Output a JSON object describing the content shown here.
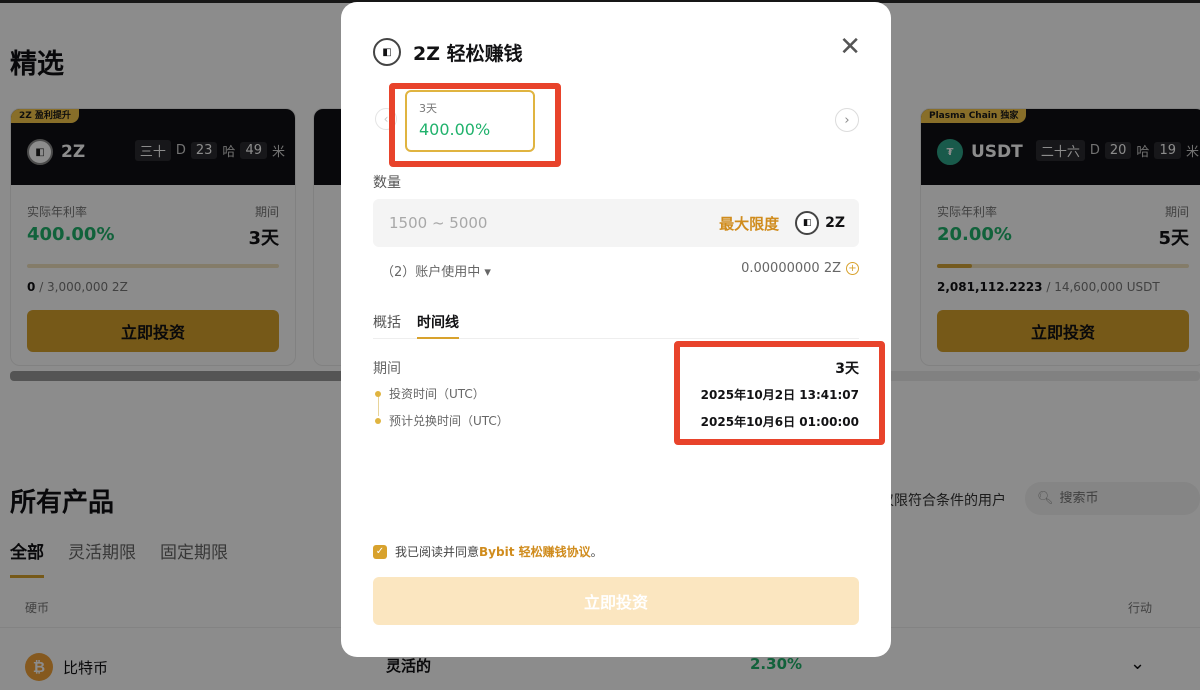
{
  "page": {
    "featured_title": "精选",
    "all_products_title": "所有产品",
    "filter_tabs": [
      "全部",
      "灵活期限",
      "固定期限"
    ],
    "eligible_text": "仅限符合条件的用户",
    "search_placeholder": "搜索币",
    "table_headers": {
      "coin": "硬币",
      "action": "行动"
    },
    "table_rows": [
      {
        "coin": "比特币",
        "type": "灵活的",
        "apr": "2.30%"
      }
    ]
  },
  "cards": [
    {
      "tag": "2Z 盈利提升",
      "coin": "2Z",
      "countdown": {
        "d": "三十",
        "d_unit": "D",
        "h": "23",
        "h_unit": "哈",
        "m": "49",
        "m_unit": "米"
      },
      "apr_label": "实际年利率",
      "apr": "400.00%",
      "term_label": "期间",
      "term": "3天",
      "supply_used": "0",
      "supply_total": "/ 3,000,000 2Z",
      "progress": 0.0,
      "button": "立即投资"
    },
    {
      "tag": "Plasma Chain 独家",
      "coin": "USDT",
      "countdown": {
        "d": "二十六",
        "d_unit": "D",
        "h": "20",
        "h_unit": "哈",
        "m": "19",
        "m_unit": "米"
      },
      "apr_label": "实际年利率",
      "apr": "20.00%",
      "term_label": "期间",
      "term": "5天",
      "supply_used": "2,081,112.2223",
      "supply_total": "/ 14,600,000 USDT",
      "progress": 0.14,
      "button": "立即投资"
    }
  ],
  "modal": {
    "title": "2Z 轻松赚钱",
    "coin_logo": "2Z",
    "term_option": {
      "label": "3天",
      "apr": "400.00%"
    },
    "quantity_label": "数量",
    "quantity_placeholder": "1500 ~ 5000",
    "max_label": "最大限度",
    "quantity_coin": "2Z",
    "account_label": "（2）账户使用中 ▾",
    "balance": "0.00000000 2Z",
    "tabs": [
      "概括",
      "时间线"
    ],
    "period_label": "期间",
    "period_value": "3天",
    "invest_time_label": "投资时间（UTC）",
    "invest_time": "2025年10月2日 13:41:07",
    "redeem_time_label": "预计兑换时间（UTC）",
    "redeem_time": "2025年10月6日 01:00:00",
    "agree_prefix": "我已阅读并同意",
    "agree_link": "Bybit 轻松赚钱协议",
    "agree_suffix": "。",
    "invest_button": "立即投资"
  },
  "colors": {
    "accent": "#d8a22d",
    "positive": "#20b26c",
    "highlight": "#e8432b"
  }
}
